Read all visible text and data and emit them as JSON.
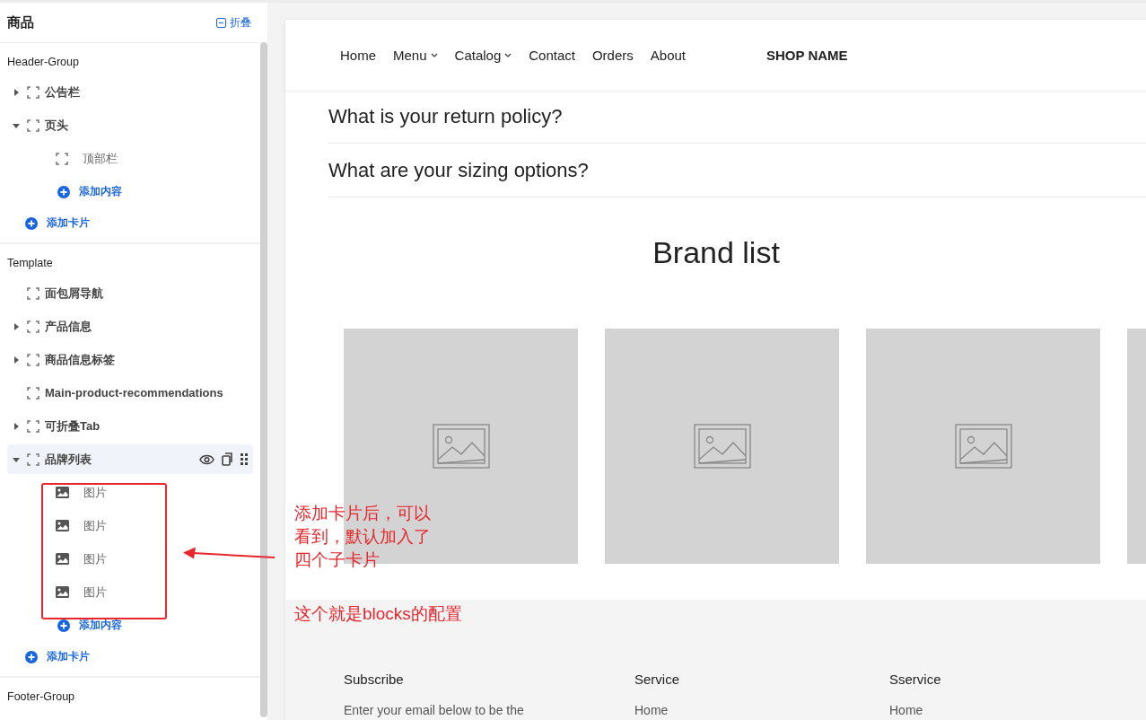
{
  "sidebar": {
    "title": "商品",
    "collapse_label": "折叠",
    "groups": [
      {
        "name": "Header-Group",
        "add_card": "添加卡片",
        "items": [
          {
            "label": "公告栏",
            "kind": "expandable",
            "expanded": false,
            "selected": false
          },
          {
            "label": "页头",
            "kind": "expandable",
            "expanded": true,
            "selected": false,
            "add_content": "添加内容",
            "children": [
              {
                "label": "顶部栏",
                "kind": "block"
              }
            ]
          }
        ]
      },
      {
        "name": "Template",
        "add_card": "添加卡片",
        "items": [
          {
            "label": "面包屑导航",
            "kind": "plain",
            "selected": false
          },
          {
            "label": "产品信息",
            "kind": "expandable",
            "expanded": false,
            "selected": false
          },
          {
            "label": "商品信息标签",
            "kind": "expandable",
            "expanded": false,
            "selected": false
          },
          {
            "label": "Main-product-recommendations",
            "kind": "plain",
            "selected": false
          },
          {
            "label": "可折叠Tab",
            "kind": "expandable",
            "expanded": false,
            "selected": false
          },
          {
            "label": "品牌列表",
            "kind": "expandable",
            "expanded": true,
            "selected": true,
            "add_content": "添加内容",
            "children": [
              {
                "label": "图片",
                "kind": "image"
              },
              {
                "label": "图片",
                "kind": "image"
              },
              {
                "label": "图片",
                "kind": "image"
              },
              {
                "label": "图片",
                "kind": "image"
              }
            ]
          }
        ]
      },
      {
        "name": "Footer-Group"
      }
    ]
  },
  "preview": {
    "nav": [
      {
        "label": "Home",
        "dropdown": false
      },
      {
        "label": "Menu",
        "dropdown": true
      },
      {
        "label": "Catalog",
        "dropdown": true
      },
      {
        "label": "Contact",
        "dropdown": false
      },
      {
        "label": "Orders",
        "dropdown": false
      },
      {
        "label": "About",
        "dropdown": false
      }
    ],
    "shop_name": "SHOP NAME",
    "faq": [
      "What is your return policy?",
      "What are your sizing options?"
    ],
    "brand_title": "Brand list",
    "footer": [
      {
        "heading": "Subscribe",
        "text": "Enter your email below to be the"
      },
      {
        "heading": "Service",
        "text": "Home"
      },
      {
        "heading": "Sservice",
        "text": "Home"
      }
    ]
  },
  "annotation": {
    "note": [
      "添加卡片后，可以",
      "看到，默认加入了",
      "四个子卡片"
    ],
    "caption": "这个就是blocks的配置"
  }
}
